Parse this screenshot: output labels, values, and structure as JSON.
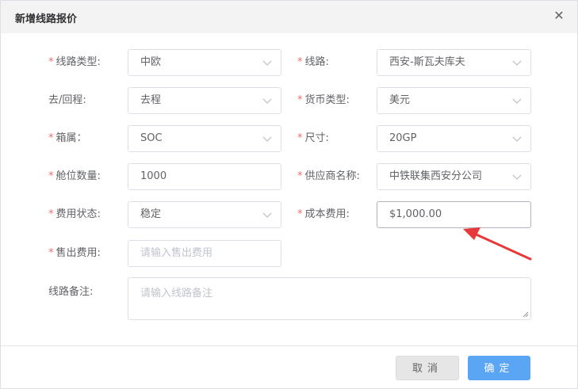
{
  "dialog": {
    "title": "新增线路报价",
    "close_glyph": "✕"
  },
  "form": {
    "route_type": {
      "label": "线路类型:",
      "value": "中欧",
      "required": true
    },
    "route": {
      "label": "线路:",
      "value": "西安-斯瓦夫库夫",
      "required": true
    },
    "direction": {
      "label": "去/回程:",
      "value": "去程",
      "required": false
    },
    "currency": {
      "label": "货币类型:",
      "value": "美元",
      "required": true
    },
    "container_owner": {
      "label": "箱属：",
      "value": "SOC",
      "required": true
    },
    "size": {
      "label": "尺寸:",
      "value": "20GP",
      "required": true
    },
    "slot_qty": {
      "label": "舱位数量:",
      "value": "1000",
      "required": true
    },
    "supplier": {
      "label": "供应商名称:",
      "value": "中铁联集西安分公司",
      "required": true
    },
    "fee_status": {
      "label": "费用状态:",
      "value": "稳定",
      "required": true
    },
    "cost": {
      "label": "成本费用:",
      "value": "$1,000.00",
      "required": true
    },
    "sale": {
      "label": "售出费用:",
      "placeholder": "请输入售出费用",
      "required": true
    },
    "remark": {
      "label": "线路备注:",
      "placeholder": "请输入线路备注",
      "required": false
    },
    "required_mark": "*"
  },
  "footer": {
    "cancel_label": "取消",
    "ok_label": "确定"
  },
  "colors": {
    "required": "#f56c6c",
    "primary": "#5aa6f5",
    "annotation_arrow": "#e8393a"
  },
  "icons": {
    "select_arrow": "chevron-down-icon",
    "close": "close-icon",
    "annotation": "red-arrow-annotation"
  }
}
